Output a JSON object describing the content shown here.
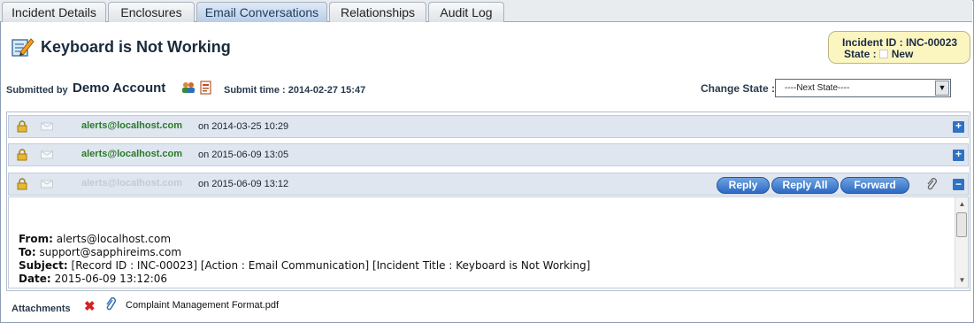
{
  "tabs": [
    {
      "label": "Incident Details",
      "active": false
    },
    {
      "label": "Enclosures",
      "active": false
    },
    {
      "label": "Email Conversations",
      "active": true
    },
    {
      "label": "Relationships",
      "active": false
    },
    {
      "label": "Audit Log",
      "active": false
    }
  ],
  "incident": {
    "title": "Keyboard is Not Working",
    "id_label": "Incident ID",
    "id_value": "INC-00023",
    "state_label": "State",
    "state_value": "New"
  },
  "submission": {
    "submitted_by_label": "Submitted by",
    "account": "Demo Account",
    "submit_time_label": "Submit time :",
    "submit_time": "2014-02-27 15:47"
  },
  "change_state": {
    "label": "Change State :",
    "selected": "----Next State----"
  },
  "messages": [
    {
      "from": "alerts@localhost.com",
      "on": "on 2014-03-25 10:29",
      "expanded": false
    },
    {
      "from": "alerts@localhost.com",
      "on": "on 2015-06-09 13:05",
      "expanded": false
    },
    {
      "from": "alerts@localhost.com",
      "on": "on 2015-06-09 13:12",
      "expanded": true
    }
  ],
  "actions": {
    "reply": "Reply",
    "reply_all": "Reply All",
    "forward": "Forward"
  },
  "email": {
    "from_label": "From:",
    "from": "alerts@localhost.com",
    "to_label": "To:",
    "to": "support@sapphireims.com",
    "subject_label": "Subject:",
    "subject": "[Record ID : INC-00023] [Action : Email Communication] [Incident Title : Keyboard is Not Working]",
    "date_label": "Date:",
    "date": "2015-06-09 13:12:06"
  },
  "attachments": {
    "label": "Attachments",
    "files": [
      "Complaint Management Format.pdf"
    ]
  },
  "colors": {
    "accent_blue": "#2d69c4",
    "sender_green": "#2a7a2a",
    "id_box_bg": "#fbf6c0"
  }
}
